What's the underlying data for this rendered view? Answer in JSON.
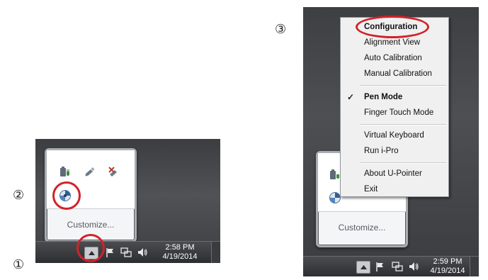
{
  "step_markers": {
    "one": "①",
    "two": "②",
    "three": "③"
  },
  "left_scene": {
    "tray_popup": {
      "icons": [
        "battery-plug-icon",
        "usb-device-icon",
        "network-disabled-icon",
        "u-pointer-icon"
      ],
      "customize_label": "Customize..."
    },
    "taskbar": {
      "icons": [
        "show-hidden-arrow-icon",
        "action-center-flag-icon",
        "network-icon",
        "volume-icon"
      ],
      "time": "2:58 PM",
      "date": "4/19/2014"
    }
  },
  "right_scene": {
    "context_menu": {
      "items": [
        {
          "label": "Configuration",
          "bold": true
        },
        {
          "label": "Alignment View"
        },
        {
          "label": "Auto Calibration"
        },
        {
          "label": "Manual Calibration"
        },
        {
          "label": "Pen Mode",
          "bold": true,
          "checked": true,
          "check_mark": "✓"
        },
        {
          "label": "Finger Touch Mode"
        },
        {
          "label": "Virtual Keyboard"
        },
        {
          "label": "Run i-Pro"
        },
        {
          "label": "About U-Pointer"
        },
        {
          "label": "Exit"
        }
      ]
    },
    "tray_popup": {
      "customize_label": "Customize..."
    },
    "taskbar": {
      "time": "2:59 PM",
      "date": "4/19/2014"
    }
  },
  "colors": {
    "highlight_ring": "#d1222a",
    "taskbar": "#3b3d40"
  }
}
